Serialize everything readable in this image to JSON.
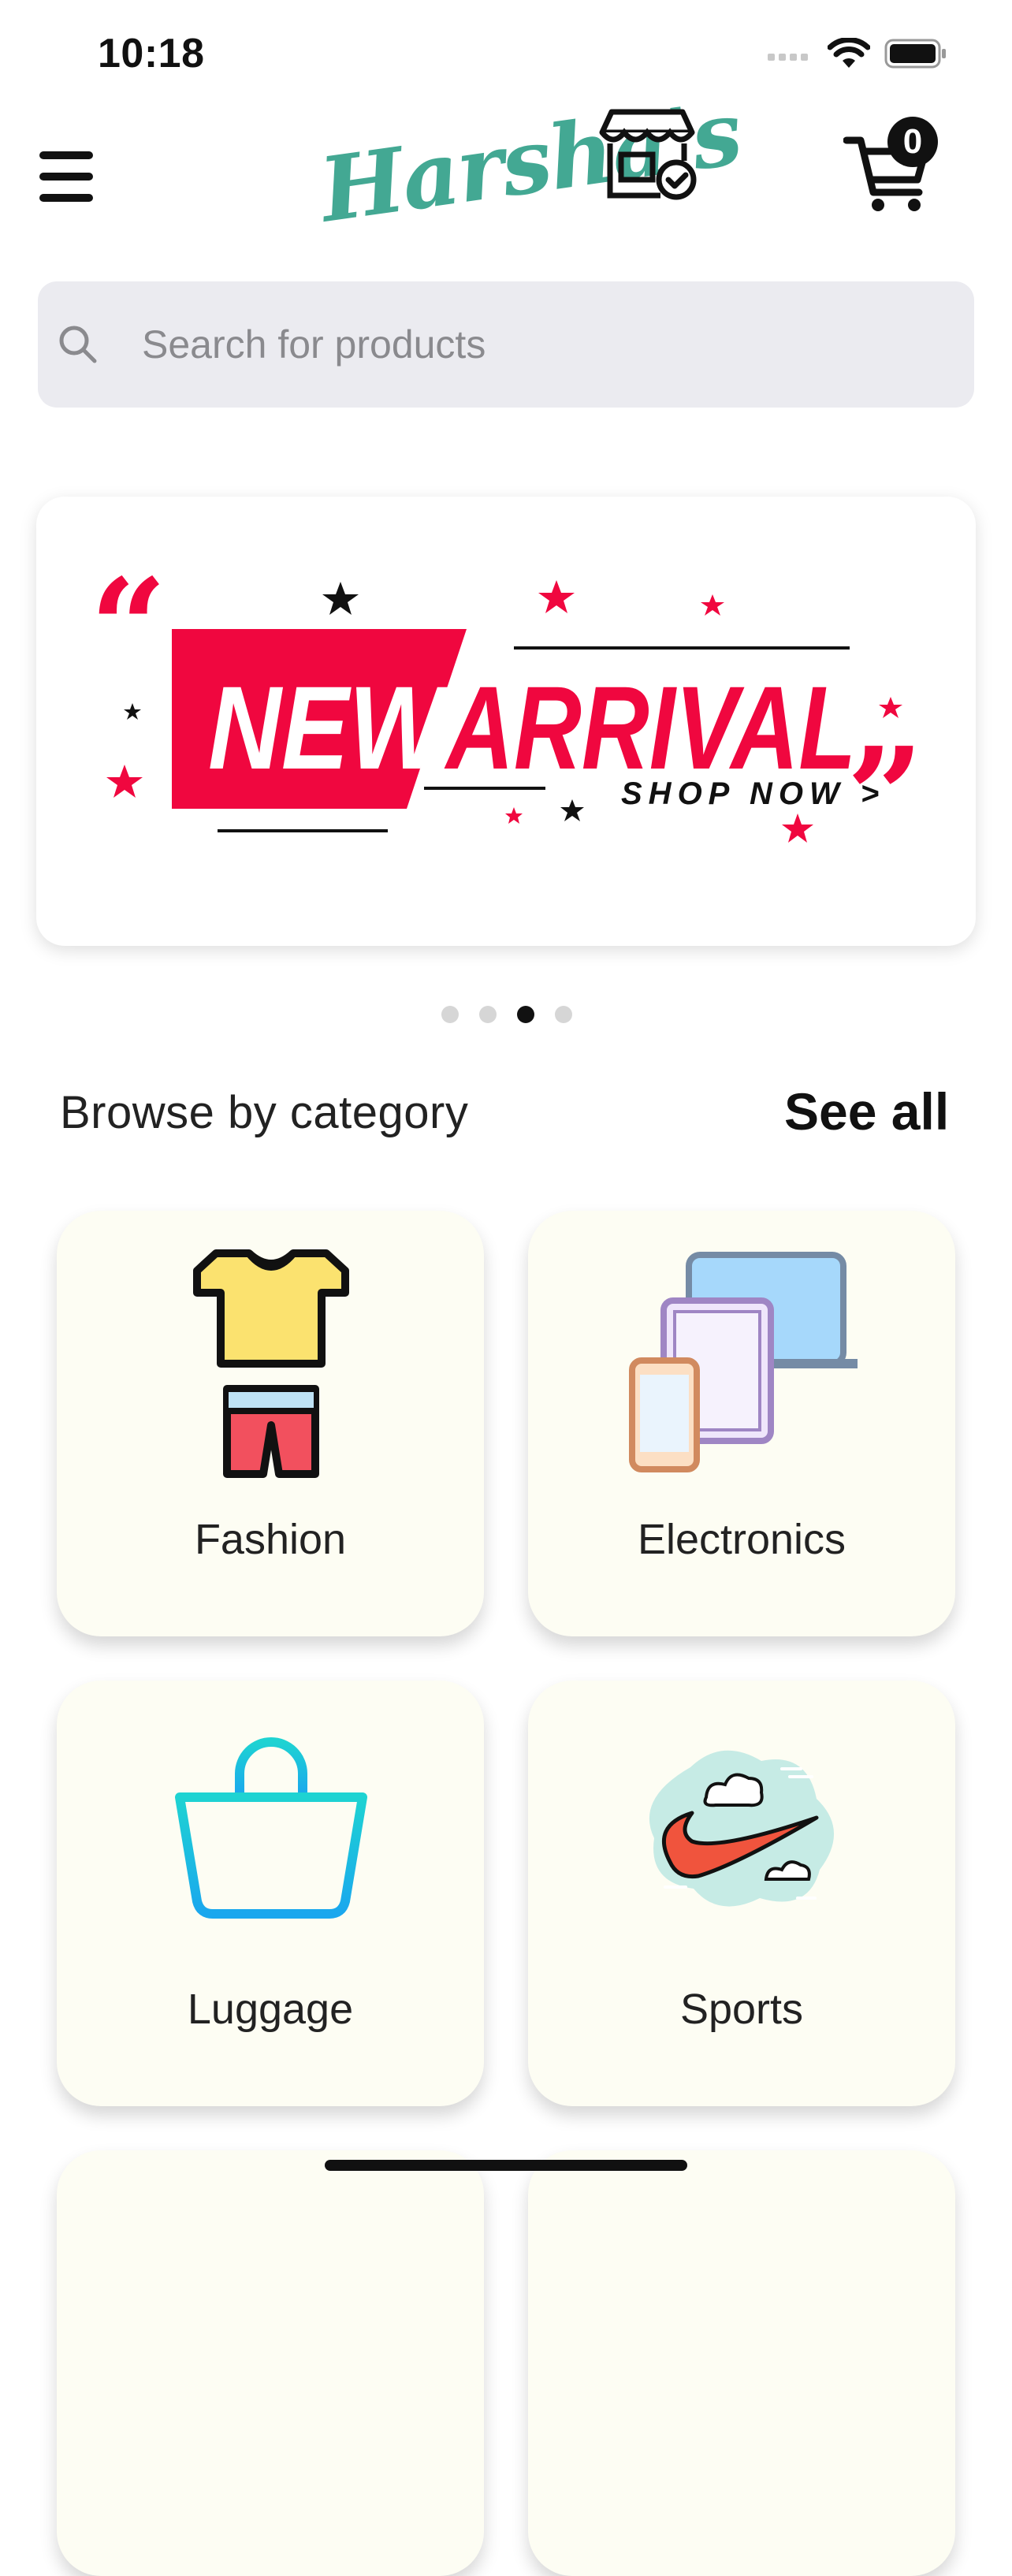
{
  "status_bar": {
    "time": "10:18"
  },
  "header": {
    "brand": "Harsha's",
    "cart_count": "0"
  },
  "search": {
    "placeholder": "Search for products"
  },
  "banner": {
    "title_left": "NEW",
    "title_right": "ARRIVAL",
    "cta": "SHOP NOW >",
    "dots": 4,
    "active_dot": 3
  },
  "section": {
    "title": "Browse by category",
    "see_all": "See all"
  },
  "categories": [
    {
      "label": "Fashion",
      "icon": "tshirt-shorts-icon"
    },
    {
      "label": "Electronics",
      "icon": "devices-icon"
    },
    {
      "label": "Luggage",
      "icon": "shopping-bag-icon"
    },
    {
      "label": "Sports",
      "icon": "swoosh-icon"
    }
  ],
  "colors": {
    "accent": "#43a893",
    "banner_red": "#f0073f",
    "card_bg": "#fdfdf3"
  }
}
